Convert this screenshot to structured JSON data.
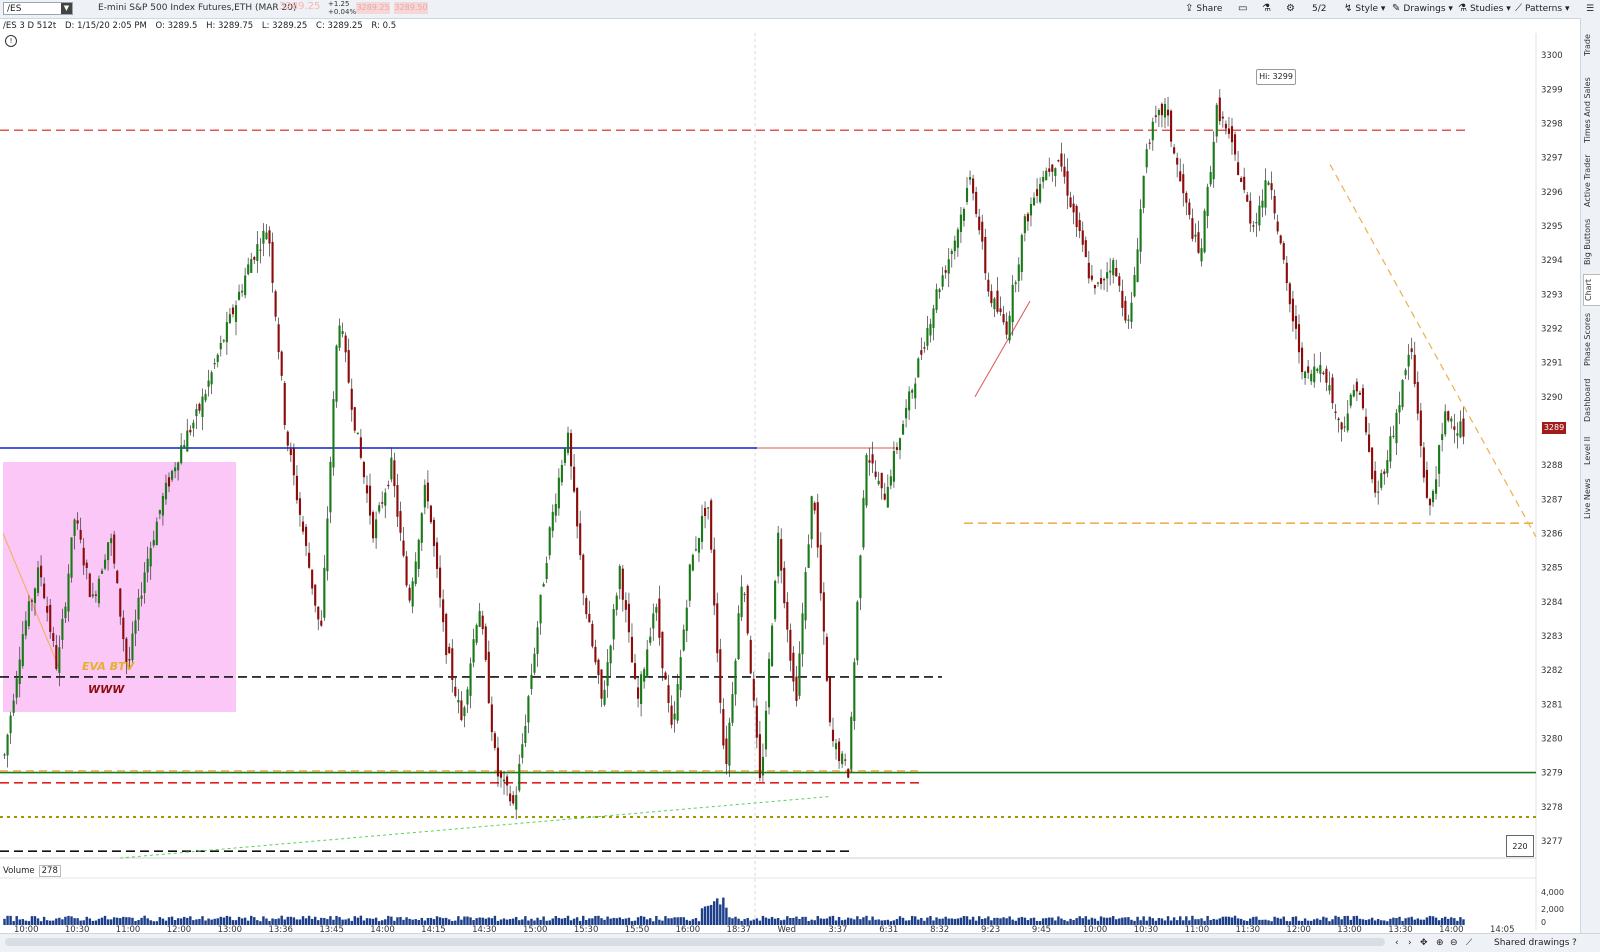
{
  "toolbar": {
    "symbol": "/ES",
    "instrument": "E-mini S&P 500 Index Futures,ETH (MAR 20)",
    "last_price": "3289.25",
    "change": "+1.25",
    "change_pct": "+0.04%",
    "bid": "3289.25",
    "ask": "3289.50",
    "share": "Share",
    "style": "Style",
    "drawings": "Drawings",
    "studies": "Studies",
    "patterns": "Patterns",
    "zoom": "5/2"
  },
  "info_bar": {
    "title": "/ES 3 D 512t",
    "date": "D: 1/15/20 2:05 PM",
    "open": "O: 3289.5",
    "high": "H: 3289.75",
    "low": "L: 3289.25",
    "close": "C: 3289.25",
    "range": "R: 0.5"
  },
  "annotations": {
    "eva": "EVA BTV",
    "www": "WWW",
    "hi": "Hi: 3299",
    "price_tag": "3289",
    "box": "220"
  },
  "volume": {
    "label": "Volume",
    "value": "278"
  },
  "right_tabs": [
    "Trade",
    "Times And Sales",
    "Active Trader",
    "Big Buttons",
    "Chart",
    "Phase Scores",
    "Dashboard",
    "Level II",
    "Live News"
  ],
  "bottom": {
    "shared_drawings": "Shared drawings"
  },
  "colors": {
    "up": "#1a7a1a",
    "down": "#8c0c0c",
    "pink": "#fbc7f7",
    "blue": "#0b22c8"
  },
  "chart_data": {
    "type": "candlestick",
    "price_axis": {
      "min": 3276.5,
      "max": 3300.5,
      "ticks": [
        "3300",
        "3299",
        "3298",
        "3297",
        "3296",
        "3295",
        "3294",
        "3293",
        "3292",
        "3291",
        "3290",
        "3289",
        "3288",
        "3287",
        "3286",
        "3285",
        "3284",
        "3283",
        "3282",
        "3281",
        "3280",
        "3279",
        "3278",
        "3277"
      ]
    },
    "time_labels": [
      "10:00",
      "10:30",
      "11:00",
      "12:00",
      "13:00",
      "13:36",
      "13:45",
      "14:00",
      "14:15",
      "14:30",
      "15:00",
      "15:30",
      "15:50",
      "16:00",
      "18:37",
      "Wed",
      "3:37",
      "6:31",
      "8:32",
      "9:23",
      "9:45",
      "10:00",
      "10:30",
      "11:00",
      "11:30",
      "12:00",
      "13:00",
      "13:30",
      "14:00",
      "14:05"
    ],
    "price_path": [
      3279.5,
      3283,
      3285,
      3282,
      3286.5,
      3284,
      3286,
      3282,
      3285,
      3287,
      3288.5,
      3289.5,
      3291,
      3292.5,
      3294,
      3295,
      3289,
      3286,
      3283,
      3292.5,
      3289,
      3286,
      3288,
      3284,
      3287.5,
      3283,
      3280.5,
      3284,
      3279,
      3278,
      3282,
      3286,
      3289,
      3284,
      3281,
      3285,
      3281,
      3284,
      3280,
      3285,
      3287,
      3279,
      3285,
      3278.5,
      3286,
      3281,
      3287.5,
      3280,
      3279,
      3288.5,
      3287,
      3289,
      3291,
      3293,
      3294.5,
      3296.5,
      3293,
      3292,
      3295,
      3296.5,
      3297,
      3295,
      3293,
      3294,
      3292,
      3297.5,
      3298.5,
      3296,
      3294,
      3298.5,
      3297,
      3295,
      3296.5,
      3293,
      3290.5,
      3291,
      3289,
      3290.5,
      3287,
      3289,
      3291.5,
      3286.5,
      3289.5,
      3289
    ],
    "volume_axis": [
      "4,000",
      "2,000",
      "0"
    ],
    "levels": [
      {
        "value": 3297.8,
        "color": "#e05555",
        "style": "dashed"
      },
      {
        "value": 3288.5,
        "color": "#0b22c8",
        "style": "solid"
      },
      {
        "value": 3281.8,
        "color": "#111111",
        "style": "dashed"
      },
      {
        "value": 3279.0,
        "color": "#1a7a1a",
        "style": "solid"
      },
      {
        "value": 3278.7,
        "color": "#e61e1e",
        "style": "dashed"
      },
      {
        "value": 3277.7,
        "color": "#9a9a00",
        "style": "dotted"
      },
      {
        "value": 3276.7,
        "color": "#111111",
        "style": "dashed"
      },
      {
        "value": 3286.3,
        "color": "#f0b050",
        "style": "dashed"
      }
    ]
  }
}
